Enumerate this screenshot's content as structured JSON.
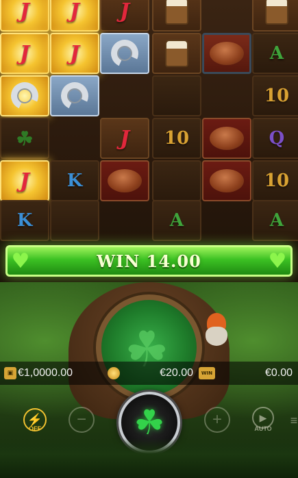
{
  "reels": {
    "tiles": [
      {
        "id": "r0c0",
        "col": 0,
        "row": 0,
        "symbol": "J",
        "style": "gold"
      },
      {
        "id": "r0c1",
        "col": 1,
        "row": 0,
        "symbol": "J",
        "style": "gold"
      },
      {
        "id": "r0c2",
        "col": 2,
        "row": 0,
        "symbol": "J",
        "style": "wood"
      },
      {
        "id": "r0c3",
        "col": 3,
        "row": 0,
        "symbol": "mug",
        "style": "wood"
      },
      {
        "id": "r0c5",
        "col": 5,
        "row": 0,
        "symbol": "mug",
        "style": "wood"
      },
      {
        "id": "r1c0",
        "col": 0,
        "row": 1,
        "symbol": "J",
        "style": "gold"
      },
      {
        "id": "r1c1",
        "col": 1,
        "row": 1,
        "symbol": "J",
        "style": "gold"
      },
      {
        "id": "r1c2",
        "col": 2,
        "row": 1,
        "symbol": "horseshoe",
        "style": "steel"
      },
      {
        "id": "r1c3",
        "col": 3,
        "row": 1,
        "symbol": "mug",
        "style": "wood"
      },
      {
        "id": "r1c4",
        "col": 4,
        "row": 1,
        "symbol": "bread",
        "style": "framed"
      },
      {
        "id": "r1c5",
        "col": 5,
        "row": 1,
        "symbol": "A",
        "style": "dark"
      },
      {
        "id": "r2c0",
        "col": 0,
        "row": 2,
        "symbol": "horseshoe",
        "style": "gold"
      },
      {
        "id": "r2c1",
        "col": 1,
        "row": 2,
        "symbol": "horseshoe",
        "style": "steel"
      },
      {
        "id": "r2c3",
        "col": 3,
        "row": 2,
        "symbol": "",
        "style": "dark"
      },
      {
        "id": "r2c5",
        "col": 5,
        "row": 2,
        "symbol": "10",
        "style": "dark"
      },
      {
        "id": "r3c0",
        "col": 0,
        "row": 3,
        "symbol": "clover",
        "style": "dark"
      },
      {
        "id": "r3c2",
        "col": 2,
        "row": 3,
        "symbol": "J",
        "style": "wood"
      },
      {
        "id": "r3c3",
        "col": 3,
        "row": 3,
        "symbol": "10",
        "style": "dark"
      },
      {
        "id": "r3c4",
        "col": 4,
        "row": 3,
        "symbol": "bread",
        "style": "red"
      },
      {
        "id": "r3c5",
        "col": 5,
        "row": 3,
        "symbol": "Q",
        "style": "dark"
      },
      {
        "id": "r4c0",
        "col": 0,
        "row": 4,
        "symbol": "J",
        "style": "gold"
      },
      {
        "id": "r4c1",
        "col": 1,
        "row": 4,
        "symbol": "K",
        "style": "dark"
      },
      {
        "id": "r4c2",
        "col": 2,
        "row": 4,
        "symbol": "bread",
        "style": "red"
      },
      {
        "id": "r4c3",
        "col": 3,
        "row": 4,
        "symbol": "",
        "style": "dark"
      },
      {
        "id": "r4c4",
        "col": 4,
        "row": 4,
        "symbol": "bread",
        "style": "red"
      },
      {
        "id": "r4c5",
        "col": 5,
        "row": 4,
        "symbol": "10",
        "style": "dark"
      },
      {
        "id": "r5c0",
        "col": 0,
        "row": 5,
        "symbol": "K",
        "style": "dark"
      },
      {
        "id": "r5c1",
        "col": 1,
        "row": 5,
        "symbol": "",
        "style": "dark"
      },
      {
        "id": "r5c3",
        "col": 3,
        "row": 5,
        "symbol": "A",
        "style": "dark"
      },
      {
        "id": "r5c5",
        "col": 5,
        "row": 5,
        "symbol": "A",
        "style": "dark"
      }
    ]
  },
  "banner": {
    "win_text": "WIN 14.00"
  },
  "info": {
    "balance": "€1,0000.00",
    "bet": "€20.00",
    "win": "€0.00",
    "win_icon_label": "WIN"
  },
  "controls": {
    "turbo_label": "OFF",
    "auto_label": "AUTO",
    "minus_glyph": "−",
    "plus_glyph": "+",
    "spin_glyph": "☘",
    "auto_glyph": "▶",
    "turbo_glyph": "⚡"
  },
  "colors": {
    "gold_highlight": "#f5c430",
    "banner_green": "#3cc123",
    "spin_clover": "#33d24a"
  }
}
